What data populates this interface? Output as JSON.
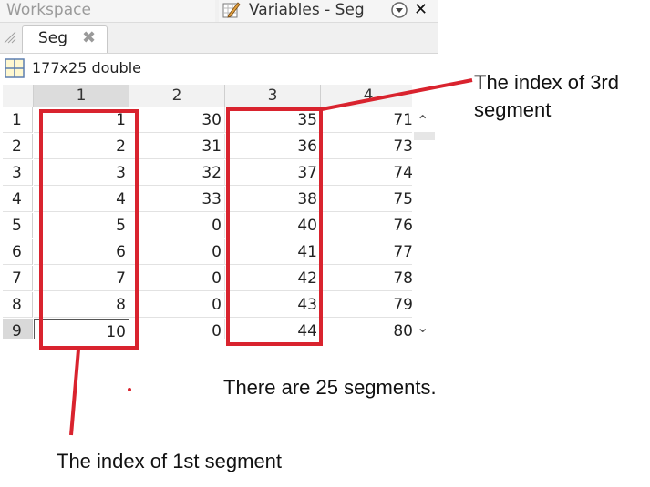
{
  "header": {
    "workspace_tab": "Workspace",
    "variables_tab": "Variables - Seg",
    "close_glyph": "✕"
  },
  "tabs": [
    {
      "label": "Seg",
      "close_glyph": "✖"
    }
  ],
  "variable_info": {
    "size": "177x25 double"
  },
  "table": {
    "columns": [
      "1",
      "2",
      "3",
      "4"
    ],
    "rows": [
      {
        "index": "1",
        "cells": [
          "1",
          "30",
          "35",
          "71"
        ]
      },
      {
        "index": "2",
        "cells": [
          "2",
          "31",
          "36",
          "73"
        ]
      },
      {
        "index": "3",
        "cells": [
          "3",
          "32",
          "37",
          "74"
        ]
      },
      {
        "index": "4",
        "cells": [
          "4",
          "33",
          "38",
          "75"
        ]
      },
      {
        "index": "5",
        "cells": [
          "5",
          "0",
          "40",
          "76"
        ]
      },
      {
        "index": "6",
        "cells": [
          "6",
          "0",
          "41",
          "77"
        ]
      },
      {
        "index": "7",
        "cells": [
          "7",
          "0",
          "42",
          "78"
        ]
      },
      {
        "index": "8",
        "cells": [
          "8",
          "0",
          "43",
          "79"
        ]
      },
      {
        "index": "9",
        "cells": [
          "10",
          "0",
          "44",
          "80"
        ]
      }
    ]
  },
  "annotations": {
    "third_segment_line1": "The index of 3rd",
    "third_segment_line2": "segment",
    "segment_count": "There are 25 segments.",
    "first_segment": "The index of 1st segment"
  },
  "colors": {
    "annotation_red": "#d9232e"
  },
  "icons": {
    "variables": "pencil-table-icon",
    "dropdown": "circle-chevron-icon",
    "close": "close-icon",
    "grid": "grid-icon"
  }
}
